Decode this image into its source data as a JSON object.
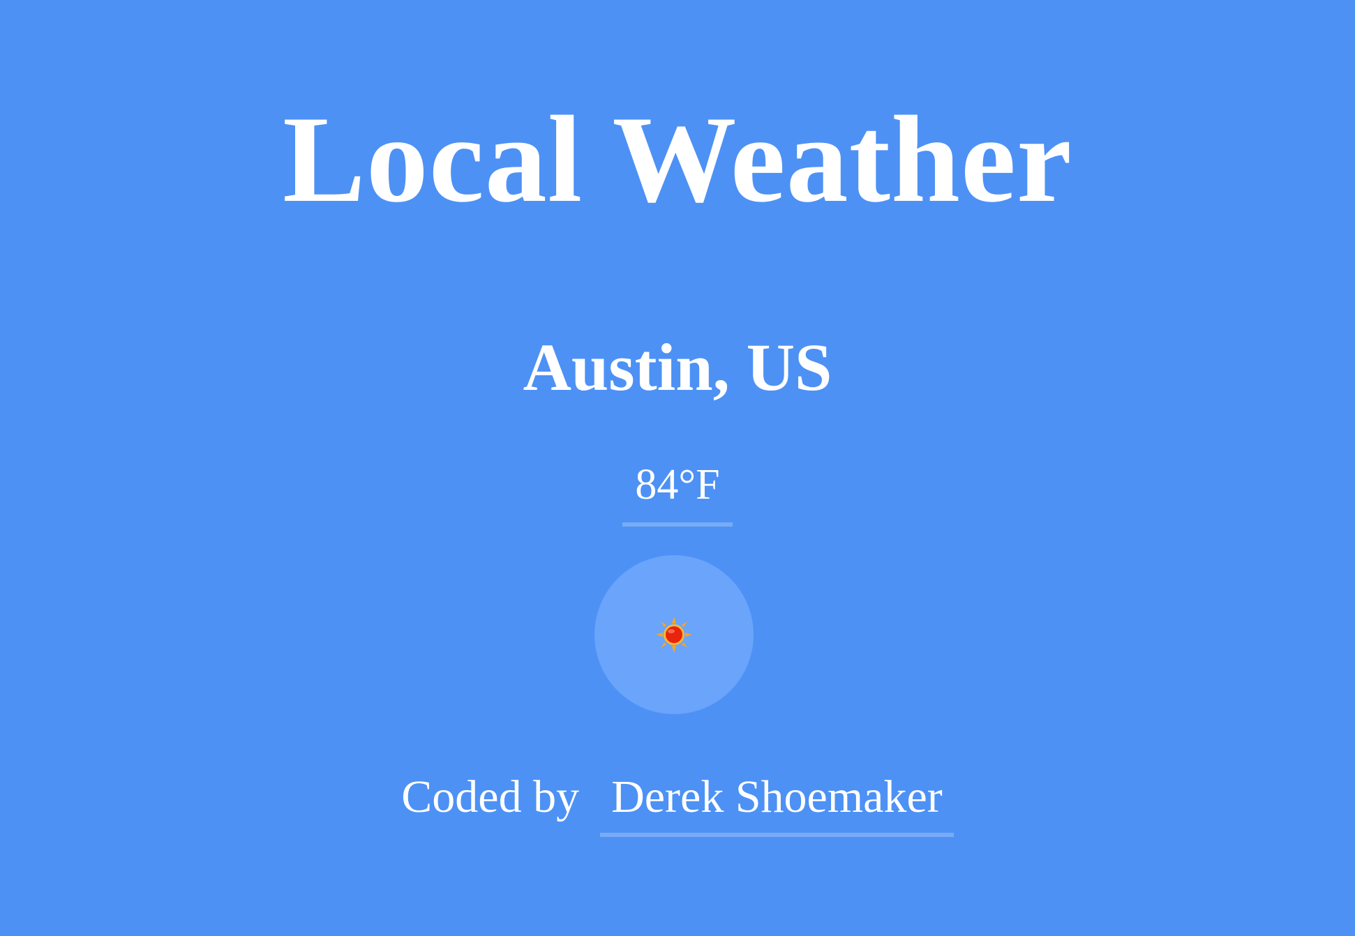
{
  "app": {
    "title": "Local Weather",
    "location": "Austin, US",
    "temperature": "84°F",
    "weather_icon": "sun-icon",
    "footer": {
      "label": "Coded by",
      "author": "Derek Shoemaker"
    },
    "colors": {
      "background": "#4d91f5",
      "icon_circle": "#6aa4fb",
      "text": "#ffffff",
      "sun_core": "#e8240c",
      "sun_rays": "#f5a623"
    }
  }
}
